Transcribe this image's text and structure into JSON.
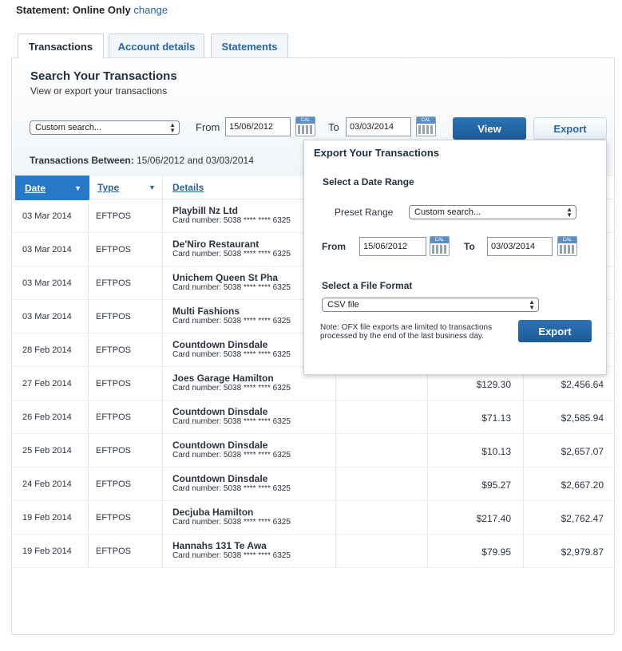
{
  "statement": {
    "label": "Statement:",
    "value": "Online Only",
    "change_link": "change"
  },
  "tabs": [
    {
      "label": "Transactions",
      "active": true
    },
    {
      "label": "Account details",
      "active": false
    },
    {
      "label": "Statements",
      "active": false
    }
  ],
  "search": {
    "title": "Search Your Transactions",
    "subtitle": "View or export your transactions",
    "range_select": "Custom search...",
    "from_label": "From",
    "from_value": "15/06/2012",
    "to_label": "To",
    "to_value": "03/03/2014",
    "cal_label": "CAL",
    "view_button": "View",
    "export_button": "Export"
  },
  "between": {
    "label": "Transactions Between:",
    "range": "15/06/2012 and 03/03/2014"
  },
  "table": {
    "headers": {
      "date": "Date",
      "type": "Type",
      "details": "Details"
    },
    "rows": [
      {
        "date": "03 Mar 2014",
        "type": "EFTPOS",
        "name": "Playbill Nz Ltd",
        "card": "Card number: 5038 **** **** 6325",
        "amount": "",
        "balance": ""
      },
      {
        "date": "03 Mar 2014",
        "type": "EFTPOS",
        "name": "De'Niro Restaurant",
        "card": "Card number: 5038 **** **** 6325",
        "amount": "",
        "balance": ""
      },
      {
        "date": "03 Mar 2014",
        "type": "EFTPOS",
        "name": "Unichem Queen St Pha",
        "card": "Card number: 5038 **** **** 6325",
        "amount": "",
        "balance": ""
      },
      {
        "date": "03 Mar 2014",
        "type": "EFTPOS",
        "name": "Multi Fashions",
        "card": "Card number: 5038 **** **** 6325",
        "amount": "",
        "balance": ""
      },
      {
        "date": "28 Feb 2014",
        "type": "EFTPOS",
        "name": "Countdown Dinsdale",
        "card": "Card number: 5038 **** **** 6325",
        "amount": "",
        "balance": ""
      },
      {
        "date": "27 Feb 2014",
        "type": "EFTPOS",
        "name": "Joes Garage Hamilton",
        "card": "Card number: 5038 **** **** 6325",
        "amount": "$129.30",
        "balance": "$2,456.64"
      },
      {
        "date": "26 Feb 2014",
        "type": "EFTPOS",
        "name": "Countdown Dinsdale",
        "card": "Card number: 5038 **** **** 6325",
        "amount": "$71.13",
        "balance": "$2,585.94"
      },
      {
        "date": "25 Feb 2014",
        "type": "EFTPOS",
        "name": "Countdown Dinsdale",
        "card": "Card number: 5038 **** **** 6325",
        "amount": "$10.13",
        "balance": "$2,657.07"
      },
      {
        "date": "24 Feb 2014",
        "type": "EFTPOS",
        "name": "Countdown Dinsdale",
        "card": "Card number: 5038 **** **** 6325",
        "amount": "$95.27",
        "balance": "$2,667.20"
      },
      {
        "date": "19 Feb 2014",
        "type": "EFTPOS",
        "name": "Decjuba Hamilton",
        "card": "Card number: 5038 **** **** 6325",
        "amount": "$217.40",
        "balance": "$2,762.47"
      },
      {
        "date": "19 Feb 2014",
        "type": "EFTPOS",
        "name": "Hannahs 131 Te Awa",
        "card": "Card number: 5038 **** **** 6325",
        "amount": "$79.95",
        "balance": "$2,979.87"
      }
    ]
  },
  "export_popup": {
    "title": "Export Your Transactions",
    "date_range_heading": "Select a Date Range",
    "preset_label": "Preset Range",
    "preset_value": "Custom search...",
    "from_label": "From",
    "from_value": "15/06/2012",
    "to_label": "To",
    "to_value": "03/03/2014",
    "format_heading": "Select a File Format",
    "format_value": "CSV file",
    "note": "Note: OFX file exports are limited to transactions processed by the end of the last business day.",
    "export_button": "Export"
  },
  "colors": {
    "accent": "#2879c8",
    "link": "#2a66a8",
    "button": "#1b5a98"
  }
}
